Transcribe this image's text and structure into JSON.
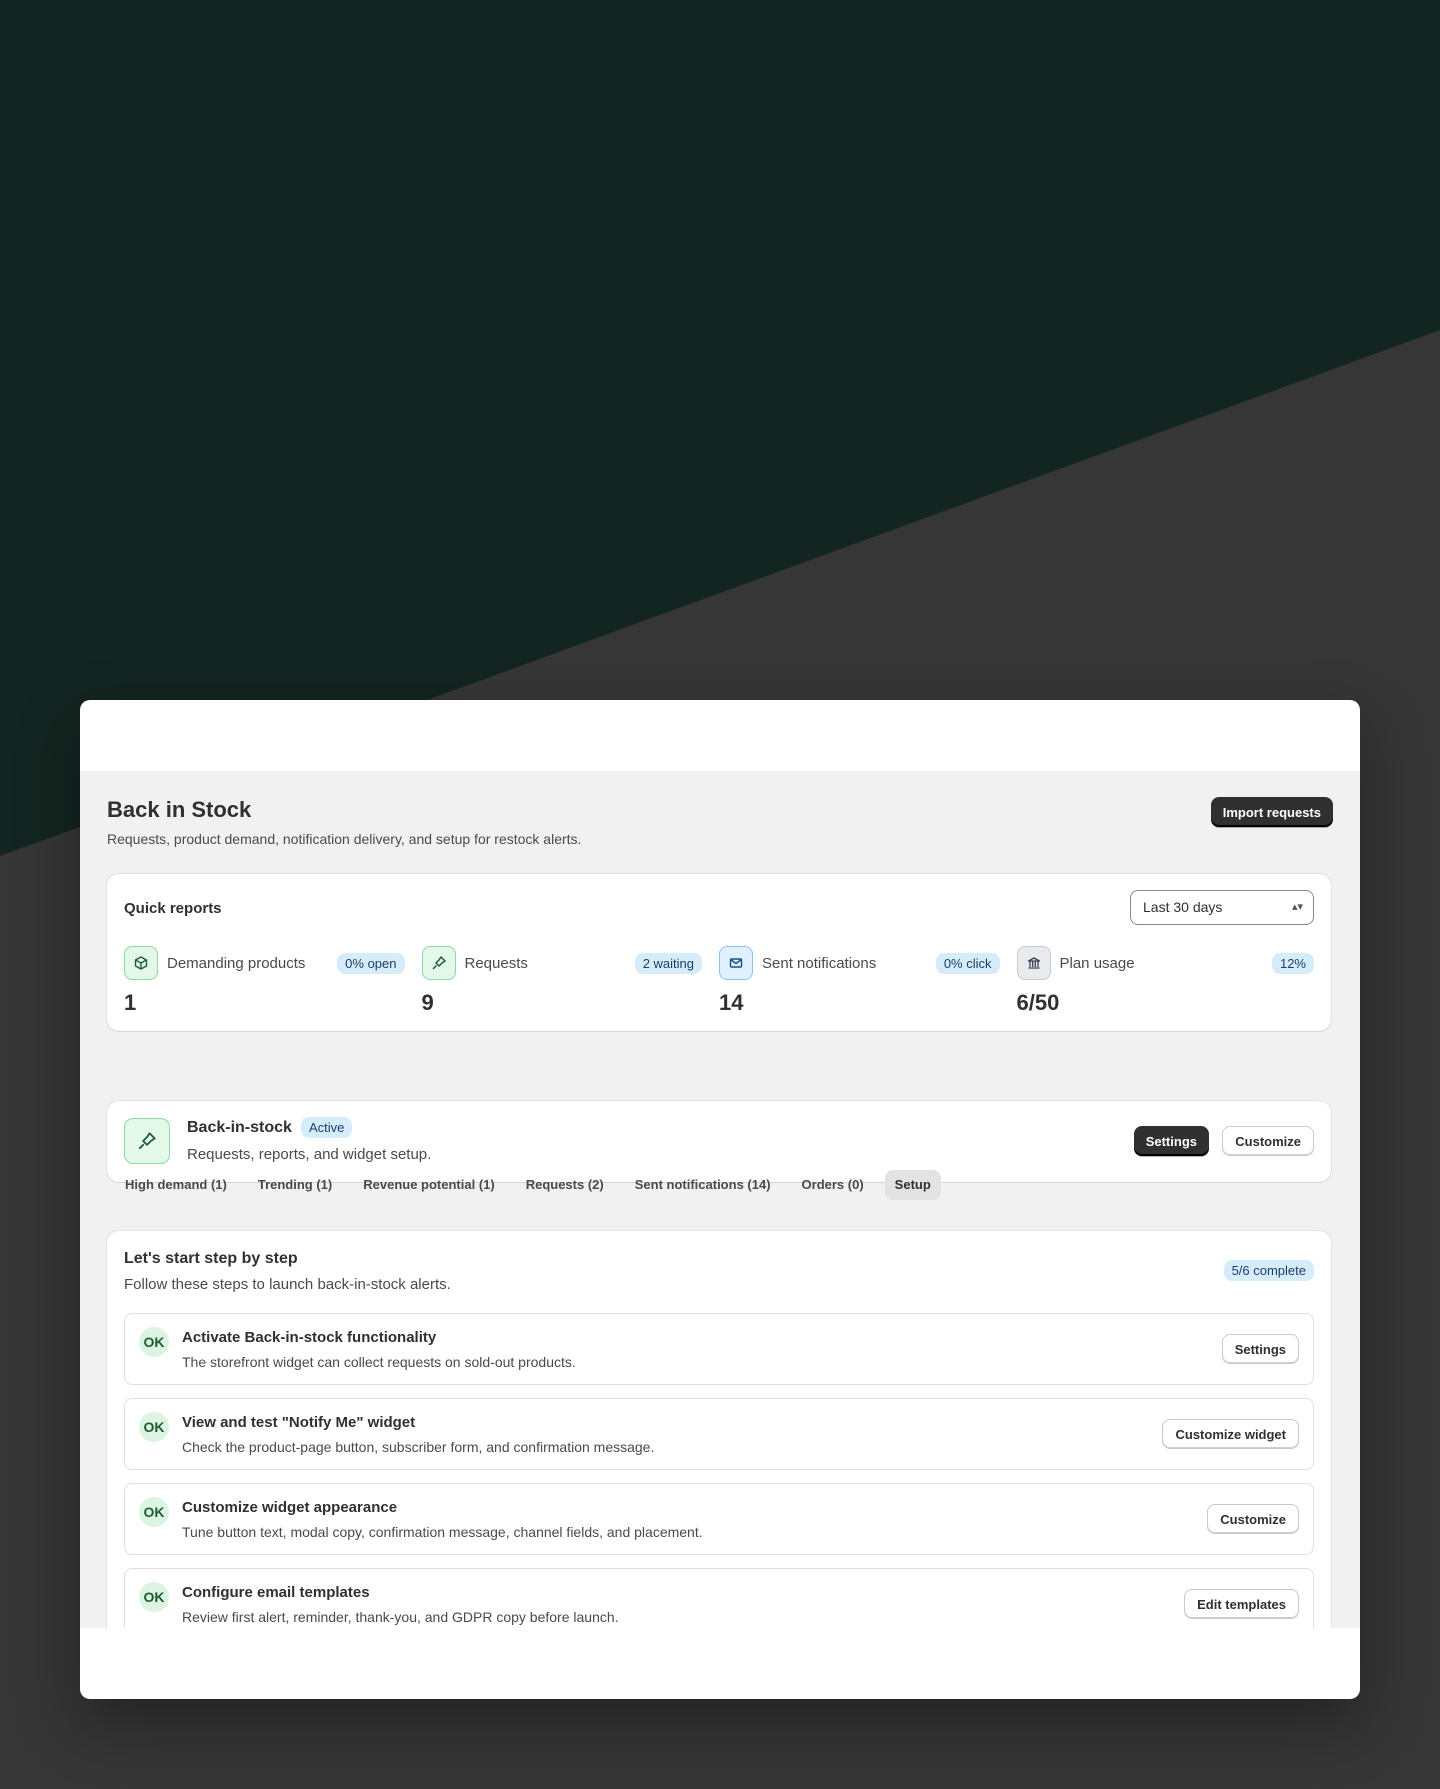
{
  "header": {
    "title": "Back in Stock",
    "subtitle": "Requests, product demand, notification delivery, and setup for restock alerts.",
    "import_label": "Import requests"
  },
  "quick_reports": {
    "title": "Quick reports",
    "range": "Last 30 days",
    "metrics": [
      {
        "label": "Demanding products",
        "badge": "0% open",
        "value": "1",
        "icon": "box-icon"
      },
      {
        "label": "Requests",
        "badge": "2 waiting",
        "value": "9",
        "icon": "pin-icon"
      },
      {
        "label": "Sent notifications",
        "badge": "0% click",
        "value": "14",
        "icon": "mail-icon"
      },
      {
        "label": "Plan usage",
        "badge": "12%",
        "value": "6/50",
        "icon": "bank-icon"
      }
    ]
  },
  "feature": {
    "title": "Back-in-stock",
    "status": "Active",
    "subtitle": "Requests, reports, and widget setup.",
    "settings_label": "Settings",
    "customize_label": "Customize"
  },
  "tabs": [
    {
      "label": "High demand (1)"
    },
    {
      "label": "Trending (1)"
    },
    {
      "label": "Revenue potential (1)"
    },
    {
      "label": "Requests (2)"
    },
    {
      "label": "Sent notifications (14)"
    },
    {
      "label": "Orders (0)"
    },
    {
      "label": "Setup",
      "active": true
    }
  ],
  "setup": {
    "title": "Let's start step by step",
    "subtitle": "Follow these steps to launch back-in-stock alerts.",
    "progress": "5/6 complete",
    "steps": [
      {
        "status": "OK",
        "title": "Activate Back-in-stock functionality",
        "desc": "The storefront widget can collect requests on sold-out products.",
        "button": "Settings"
      },
      {
        "status": "OK",
        "title": "View and test \"Notify Me\" widget",
        "desc": "Check the product-page button, subscriber form, and confirmation message.",
        "button": "Customize widget"
      },
      {
        "status": "OK",
        "title": "Customize widget appearance",
        "desc": "Tune button text, modal copy, confirmation message, channel fields, and placement.",
        "button": "Customize"
      },
      {
        "status": "OK",
        "title": "Configure email templates",
        "desc": "Review first alert, reminder, thank-you, and GDPR copy before launch.",
        "button": "Edit templates"
      }
    ]
  },
  "colors": {
    "background": "#363636",
    "dark_wedge": "#132520",
    "accent_green": "#e3f8e8",
    "badge_blue": "#d7ecfb",
    "primary_button": "#303030"
  }
}
